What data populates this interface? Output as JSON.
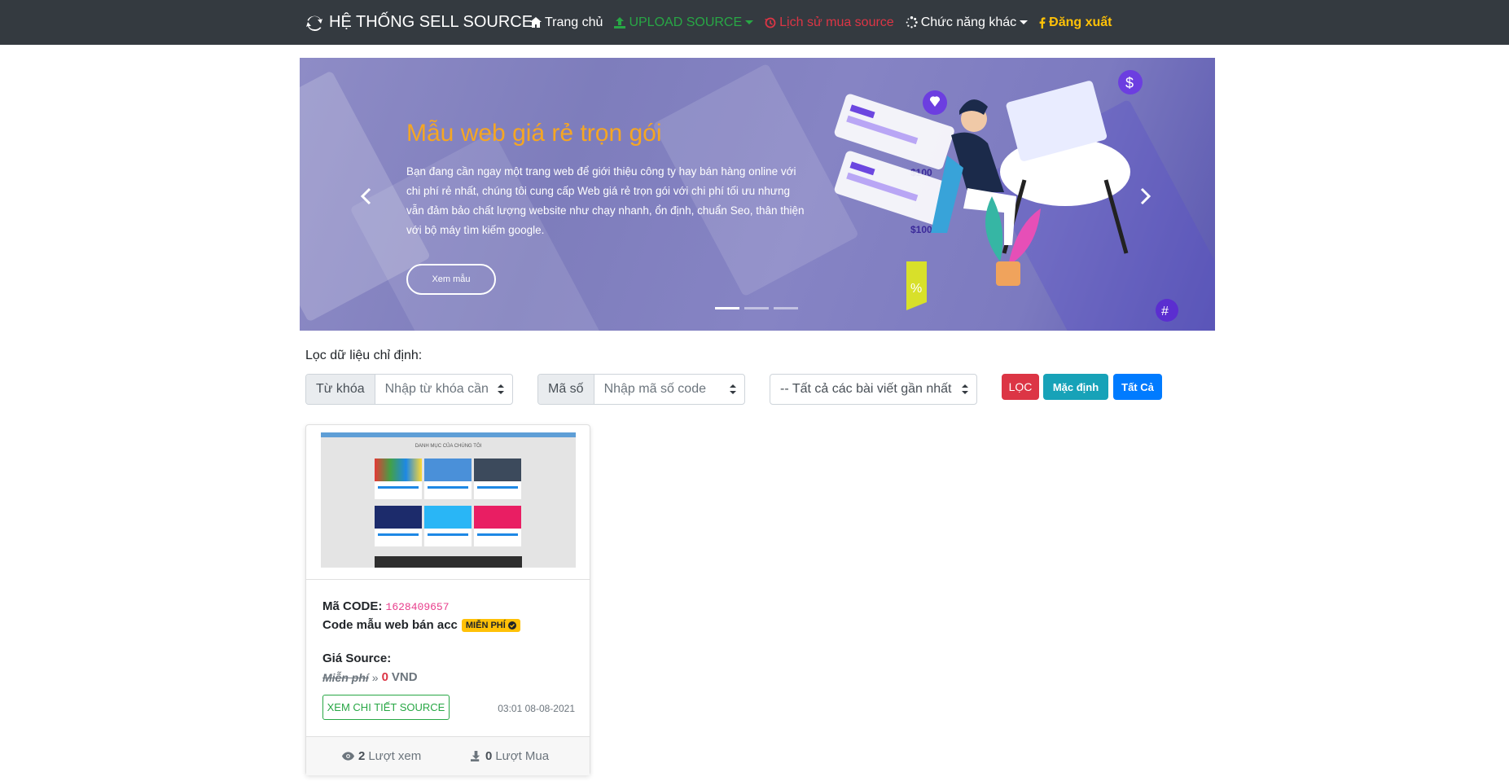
{
  "nav": {
    "brand": "HỆ THỐNG SELL SOURCE",
    "items": [
      {
        "label": "Trang chủ",
        "icon": "home-icon",
        "color": "#ffffff"
      },
      {
        "label": "UPLOAD SOURCE",
        "icon": "upload-icon",
        "color": "#28a745",
        "dropdown": true
      },
      {
        "label": "Lịch sử mua source",
        "icon": "history-icon",
        "color": "#dc3545"
      },
      {
        "label": "Chức năng khác",
        "icon": "spinner-icon",
        "color": "#ffffff",
        "dropdown": true
      },
      {
        "label": "Đăng xuất",
        "icon": "facebook-icon",
        "color": "#ffc107"
      }
    ]
  },
  "banner": {
    "title": "Mẫu web giá rẻ trọn gói",
    "description": "Bạn đang cần ngay một trang web để giới thiệu công ty hay bán hàng online với chi phí rẻ nhất, chúng tôi cung cấp Web giá rẻ trọn gói với chi phí tối ưu nhưng vẫn đảm bảo chất lượng website như chạy nhanh, ổn định, chuẩn Seo, thân thiện với bộ máy tìm kiếm google.",
    "button": "Xem mẫu",
    "slides": 3,
    "active_slide": 1,
    "illustration_labels": {
      "price1": "$100",
      "price2": "$100",
      "percent": "%",
      "dollar": "$",
      "hash": "#"
    }
  },
  "filter": {
    "label": "Lọc dữ liệu chỉ định:",
    "keyword_prefix": "Từ khóa",
    "keyword_placeholder": "Nhập từ khóa cần",
    "code_prefix": "Mã số",
    "code_placeholder": "Nhập mã số code",
    "sort_selected": "-- Tất cả các bài viết gần nhất",
    "btn_filter": "LỌC",
    "btn_default": "Mặc định",
    "btn_all": "Tất Cả"
  },
  "card": {
    "thumb_caption": "DANH MỤC CỦA CHÚNG TÔI",
    "code_label": "Mã CODE:",
    "code_value": "1628409657",
    "name": "Code mẫu web bán acc",
    "badge": "MIỄN PHÍ",
    "price_label": "Giá Source:",
    "old_price": "Miễn phí",
    "separator": "»",
    "price": "0",
    "currency": "VND",
    "detail_button": "XEM CHI TIẾT SOURCE",
    "date": "03:01 08-08-2021",
    "views": "2",
    "views_label": "Lượt xem",
    "buys": "0",
    "buys_label": "Lượt Mua"
  }
}
